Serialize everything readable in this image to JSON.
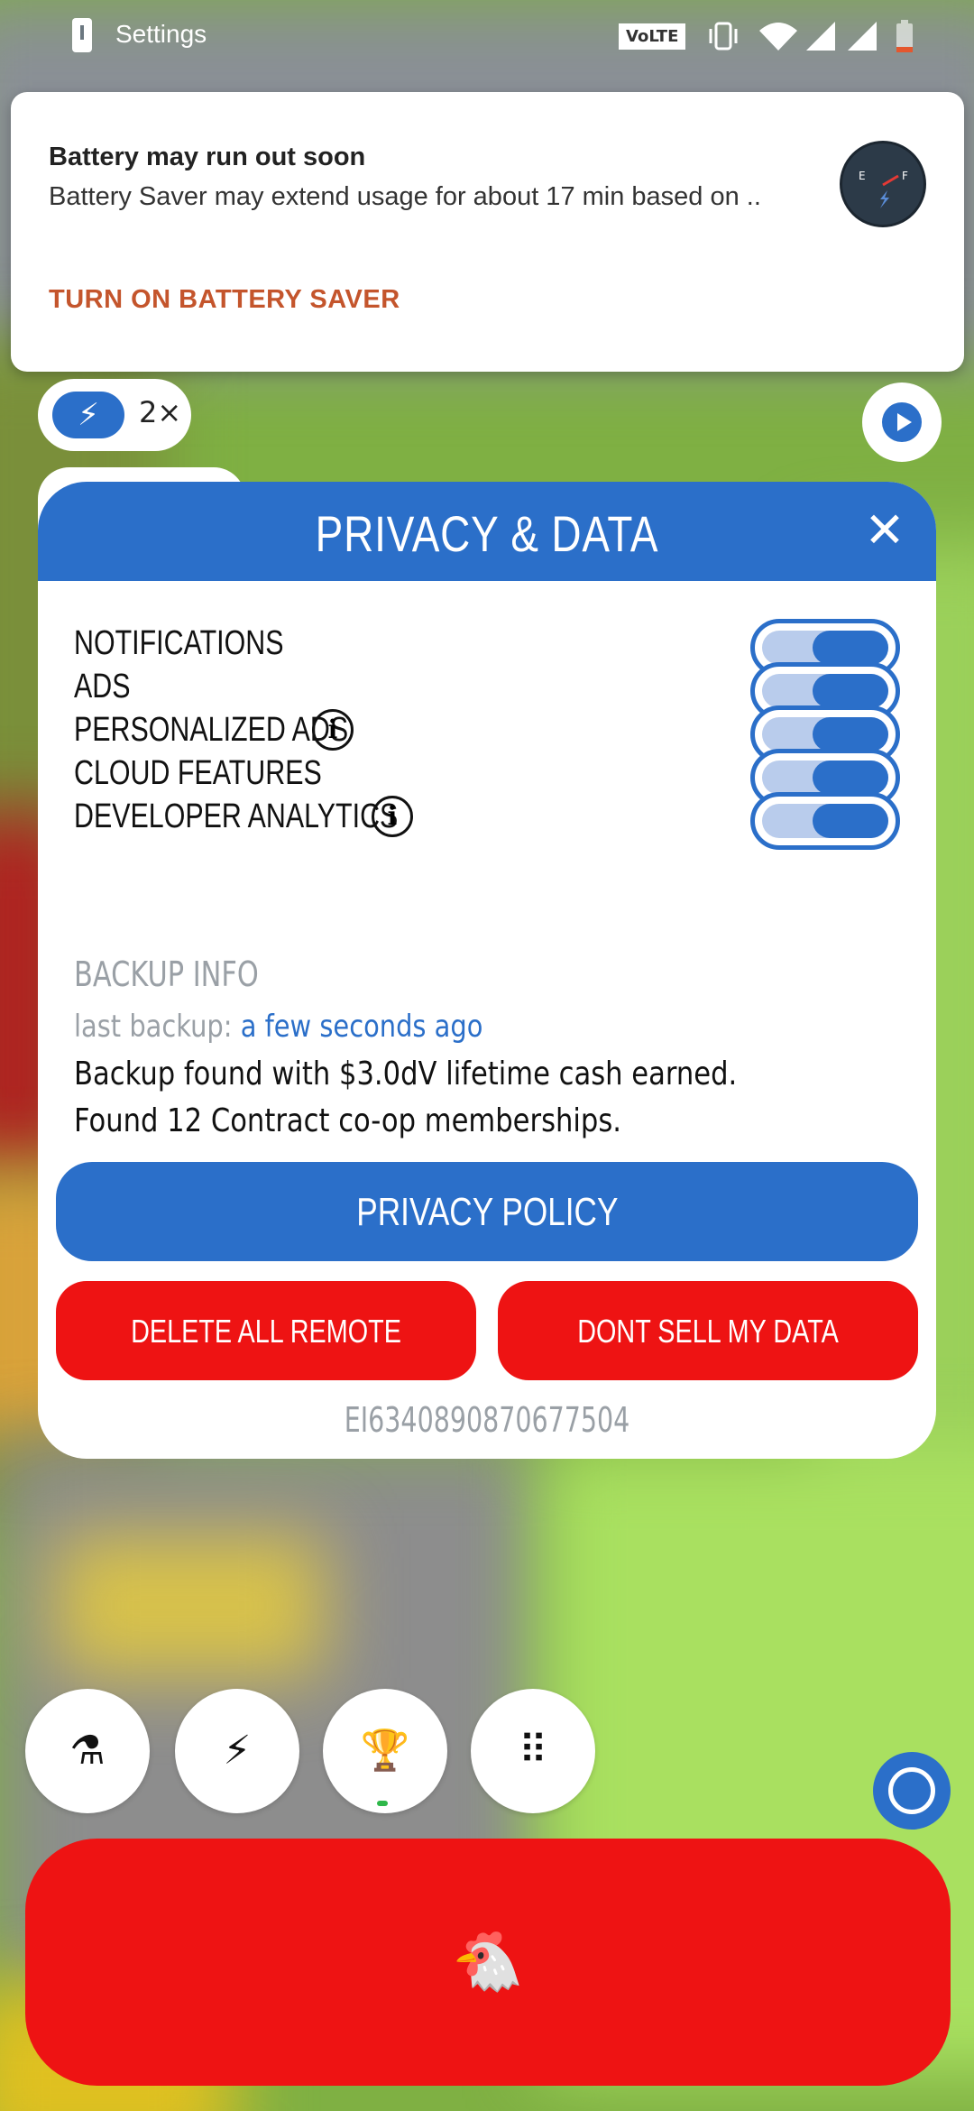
{
  "status_bar": {
    "app_name": "Settings",
    "network_badge": "VoLTE"
  },
  "notification": {
    "title": "Battery may run out soon",
    "body": "Battery Saver may extend usage for about 17 min based on ..",
    "action": "TURN ON BATTERY SAVER"
  },
  "hud": {
    "boost_multiplier": "2×"
  },
  "modal": {
    "title": "PRIVACY & DATA",
    "close_glyph": "✕",
    "settings": [
      {
        "label": "NOTIFICATIONS",
        "enabled": true
      },
      {
        "label": "ADS",
        "enabled": true
      },
      {
        "label": "PERSONALIZED ADS",
        "enabled": true
      },
      {
        "label": "CLOUD FEATURES",
        "enabled": true
      },
      {
        "label": "DEVELOPER ANALYTICS",
        "enabled": true
      }
    ],
    "info_glyph": "i",
    "backup": {
      "title": "BACKUP INFO",
      "last_backup_prefix": "last backup: ",
      "last_backup_time": "a few seconds ago",
      "found_cash": "Backup found with $3.0dV lifetime cash earned.",
      "found_coop": "Found 12 Contract co-op memberships."
    },
    "buttons": {
      "privacy_policy": "PRIVACY POLICY",
      "delete_remote": "DELETE ALL REMOTE DATA",
      "dont_sell": "DONT SELL MY DATA"
    },
    "user_id": "EI6340890870677504"
  },
  "bottom_nav": {
    "items": [
      {
        "icon": "flask-icon",
        "glyph": "⚗"
      },
      {
        "icon": "lightning-icon",
        "glyph": "⚡"
      },
      {
        "icon": "trophy-icon",
        "glyph": "🏆"
      },
      {
        "icon": "grid-icon",
        "glyph": "⠿"
      }
    ],
    "main_button_icon": "chicken-icon",
    "main_glyph": "🐔"
  },
  "colors": {
    "accent_blue": "#2b6fc9",
    "danger_red": "#ee1313",
    "notif_action": "#c4552c"
  }
}
